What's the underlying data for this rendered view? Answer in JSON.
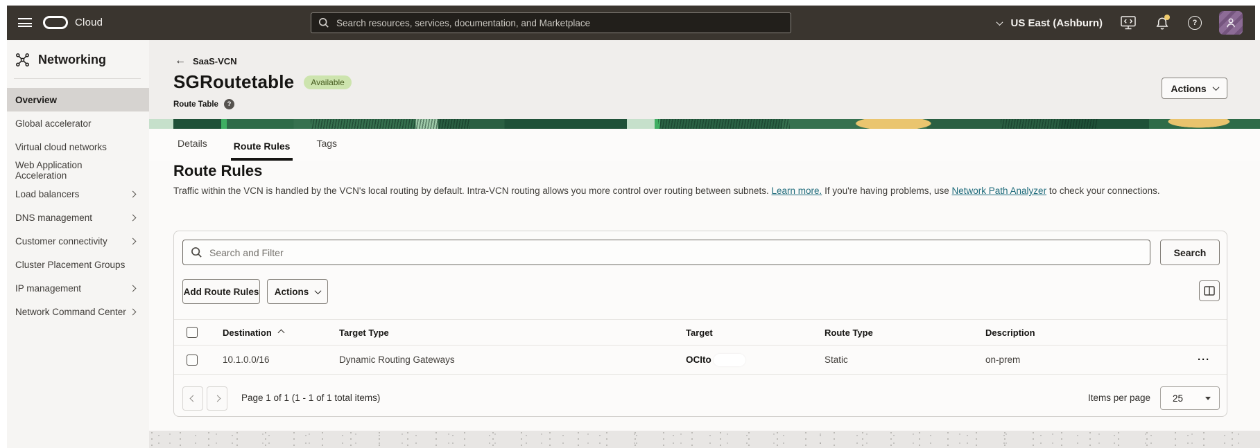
{
  "topbar": {
    "brand": "Cloud",
    "search_placeholder": "Search resources, services, documentation, and Marketplace",
    "region": "US East (Ashburn)"
  },
  "sidebar": {
    "title": "Networking",
    "items": [
      {
        "label": "Overview"
      },
      {
        "label": "Global accelerator"
      },
      {
        "label": "Virtual cloud networks"
      },
      {
        "label": "Web Application Acceleration"
      },
      {
        "label": "Load balancers"
      },
      {
        "label": "DNS management"
      },
      {
        "label": "Customer connectivity"
      },
      {
        "label": "Cluster Placement Groups"
      },
      {
        "label": "IP management"
      },
      {
        "label": "Network Command Center"
      }
    ]
  },
  "page": {
    "breadcrumb": "SaaS-VCN",
    "title": "SGRoutetable",
    "status": "Available",
    "resource_type": "Route Table",
    "actions_label": "Actions"
  },
  "tabs": {
    "details": "Details",
    "route_rules": "Route Rules",
    "tags": "Tags"
  },
  "section": {
    "heading": "Route Rules",
    "desc_part1": "Traffic within the VCN is handled by the VCN's local routing by default. Intra-VCN routing allows you more control over routing between subnets. ",
    "link_learn_more": "Learn more.",
    "desc_part2": " If you're having problems, use ",
    "link_path_analyzer": "Network Path Analyzer",
    "desc_part3": " to check your connections."
  },
  "toolbar": {
    "filter_placeholder": "Search and Filter",
    "search_label": "Search",
    "add_label": "Add Route Rules",
    "actions_label": "Actions"
  },
  "table": {
    "columns": {
      "destination": "Destination",
      "target_type": "Target Type",
      "target": "Target",
      "route_type": "Route Type",
      "description": "Description"
    },
    "row": {
      "destination": "10.1.0.0/16",
      "target_type": "Dynamic Routing Gateways",
      "target": "OCIto",
      "route_type": "Static",
      "description": "on-prem"
    }
  },
  "pagination": {
    "summary": "Page 1 of 1 (1 - 1 of 1 total items)",
    "items_per_page_label": "Items per page",
    "items_per_page_value": "25"
  },
  "icons": {
    "back_arrow": "←",
    "question_mark": "?",
    "ellipsis": "···"
  },
  "colors": {
    "topbar_bg": "#3a352f",
    "status_badge_bg": "#cde4ae",
    "status_badge_text": "#44591d",
    "link": "#1e6b7b",
    "banner_green": "#2e6b48",
    "banner_yellow": "#eac56f",
    "avatar_bg": "#8d6c96",
    "notification_dot": "#efcb6e",
    "tab_underline": "#161513"
  }
}
